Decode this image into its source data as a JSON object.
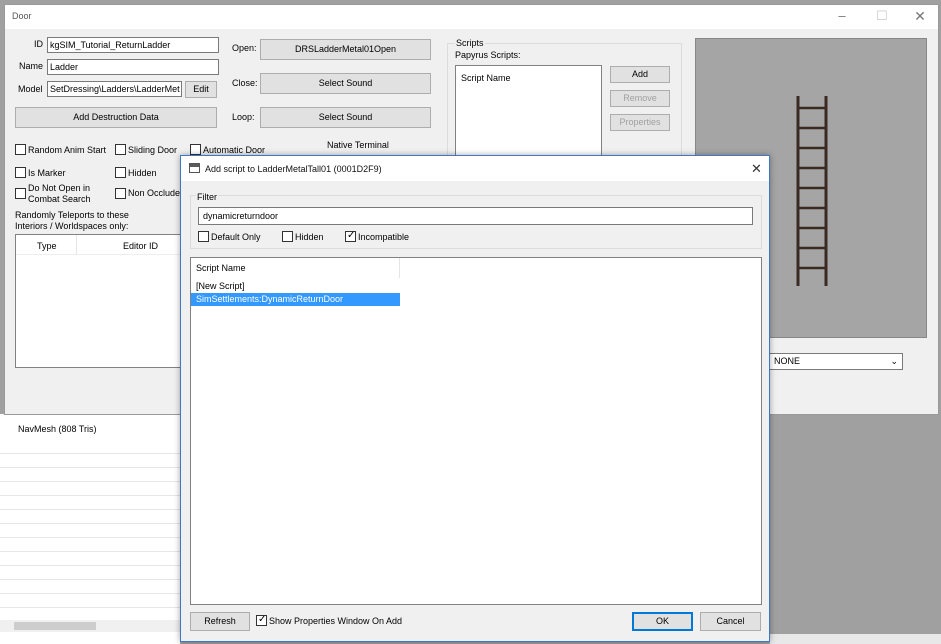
{
  "background": {
    "navmesh_label": "NavMesh",
    "navmesh_count": "(808 Tris)"
  },
  "door_window": {
    "title": "Door",
    "id_label": "ID",
    "id_value": "kgSIM_Tutorial_ReturnLadder",
    "name_label": "Name",
    "name_value": "Ladder",
    "model_label": "Model",
    "model_value": "SetDressing\\Ladders\\LadderMet",
    "edit_button": "Edit",
    "add_destruction_button": "Add Destruction Data",
    "open_label": "Open:",
    "open_value": "DRSLadderMetal01Open",
    "close_label": "Close:",
    "close_value": "Select Sound",
    "loop_label": "Loop:",
    "loop_value": "Select Sound",
    "native_terminal_label": "Native Terminal",
    "checks": {
      "random_anim_start": "Random Anim Start",
      "sliding_door": "Sliding Door",
      "automatic_door": "Automatic Door",
      "is_marker": "Is Marker",
      "hidden": "Hidden",
      "do_not_open_line1": "Do Not Open in",
      "do_not_open_line2": "Combat Search",
      "non_occluder": "Non Occlude"
    },
    "teleport_label_line1": "Randomly Teleports to these",
    "teleport_label_line2": "Interiors / Worldspaces only:",
    "teleport_columns": [
      "Type",
      "Editor ID"
    ],
    "scripts_group_label": "Scripts",
    "papyrus_label": "Papyrus Scripts:",
    "script_name_header": "Script Name",
    "add_button": "Add",
    "remove_button": "Remove",
    "properties_button": "Properties",
    "preview_combo_value": "NONE"
  },
  "dialog": {
    "title": "Add script to LadderMetalTall01 (0001D2F9)",
    "filter_label": "Filter",
    "filter_value": "dynamicreturndoor",
    "default_only": {
      "label": "Default Only",
      "checked": false
    },
    "hidden": {
      "label": "Hidden",
      "checked": false
    },
    "incompatible": {
      "label": "Incompatible",
      "checked": true
    },
    "column_header": "Script Name",
    "rows": [
      "[New Script]",
      "SimSettlements:DynamicReturnDoor"
    ],
    "selected_row": 1,
    "refresh_button": "Refresh",
    "show_properties": {
      "label": "Show Properties Window On Add",
      "checked": true
    },
    "ok_button": "OK",
    "cancel_button": "Cancel"
  },
  "colors": {
    "selection": "#3399ff",
    "dialog_border": "#3c78c8",
    "preview_bg": "#a5a5a5",
    "ladder": "#3b2a22"
  }
}
